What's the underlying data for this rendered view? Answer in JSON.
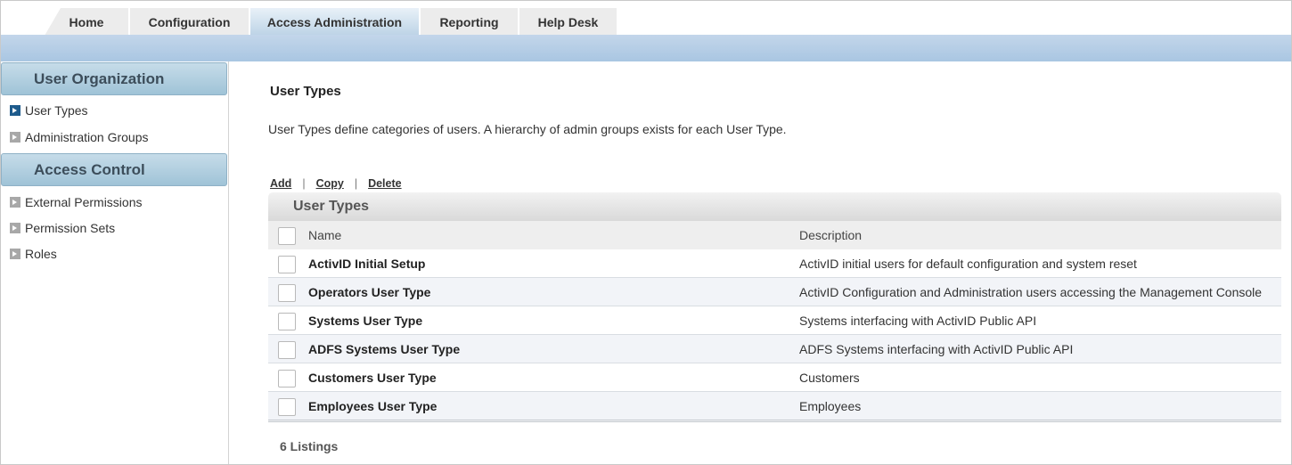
{
  "nav_tabs": [
    {
      "label": "Home",
      "active": false
    },
    {
      "label": "Configuration",
      "active": false
    },
    {
      "label": "Access Administration",
      "active": true
    },
    {
      "label": "Reporting",
      "active": false
    },
    {
      "label": "Help Desk",
      "active": false
    }
  ],
  "sidebar": {
    "sections": [
      {
        "title": "User Organization",
        "items": [
          {
            "label": "User Types",
            "active": true
          },
          {
            "label": "Administration Groups",
            "active": false
          }
        ]
      },
      {
        "title": "Access Control",
        "items": [
          {
            "label": "External Permissions",
            "active": false
          },
          {
            "label": "Permission Sets",
            "active": false
          },
          {
            "label": "Roles",
            "active": false
          }
        ]
      }
    ]
  },
  "main": {
    "title": "User Types",
    "description": "User Types define categories of users. A hierarchy of admin groups exists for each User Type.",
    "actions": {
      "add": "Add",
      "copy": "Copy",
      "delete": "Delete",
      "separator": "|"
    },
    "grid": {
      "title": "User Types",
      "columns": {
        "name": "Name",
        "description": "Description"
      },
      "rows": [
        {
          "name": "ActivID Initial Setup",
          "description": "ActivID initial users for default configuration and system reset"
        },
        {
          "name": "Operators User Type",
          "description": "ActivID Configuration and Administration users accessing the Management Console"
        },
        {
          "name": "Systems User Type",
          "description": "Systems interfacing with ActivID Public API"
        },
        {
          "name": "ADFS Systems User Type",
          "description": "ADFS Systems interfacing with ActivID Public API"
        },
        {
          "name": "Customers User Type",
          "description": "Customers"
        },
        {
          "name": "Employees User Type",
          "description": "Employees"
        }
      ]
    },
    "listings": "6 Listings"
  },
  "colors": {
    "active_tab": "#bcd3e6",
    "header_bar": "#a9c6e2",
    "sidebar_header": "#9fc3d7",
    "active_arrow": "#1e5b8c",
    "alt_row": "#f2f4f8"
  }
}
